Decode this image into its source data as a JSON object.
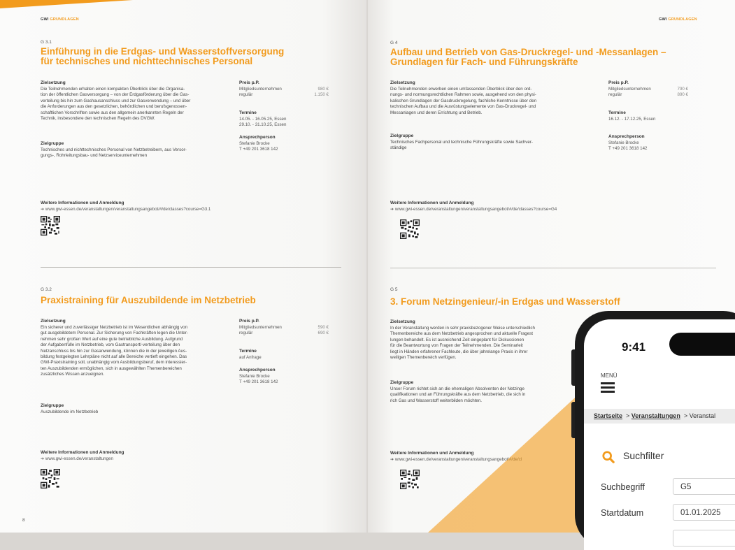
{
  "header": {
    "gwi": "GWI",
    "grundlagen": "GRUNDLAGEN"
  },
  "left_page": {
    "page_number": "8",
    "c1": {
      "code": "G 3.1",
      "title_l1": "Einführung in die Erdgas- und Wasserstoffversorgung",
      "title_l2": "für technisches und nichttechnisches Personal",
      "ziel_label": "Zielsetzung",
      "ziel_lines": [
        "Die Teilnehmenden erhalten einen kompakten Überblick über die Organisa-",
        "tion der öffentlichen Gasversorgung – von der Erdgasförderung über die Gas-",
        "verteilung bis hin zum Gashausanschluss und zur Gasverwendung – und über",
        "die Anforderungen aus den gesetzlichen, behördlichen und berufsgenossen-",
        "schaftlichen Vorschriften sowie aus den allgemein anerkannten Regeln der",
        "Technik, insbesondere den technischen Regeln des DVGW."
      ],
      "gruppe_label": "Zielgruppe",
      "gruppe_lines": [
        "Technisches und nichttechnisches Personal von Netzbetreibern, aus Versor-",
        "gungs-, Rohrleitungsbau- und Netzserviceunternehmen"
      ],
      "preis_label": "Preis p.P.",
      "preis_rows": [
        "Mitgliedsunternehmen",
        "regulär"
      ],
      "preis_vals": [
        "980 €",
        "1.150 €"
      ],
      "termine_label": "Termine",
      "termine": [
        "14.05. - 16.05.25, Essen",
        "29.10. - 31.10.25, Essen"
      ],
      "ansprech_label": "Ansprechperson",
      "ansprech": [
        "Stefanie Brocke",
        "T +49 201 3618 142"
      ],
      "more_label": "Weitere Informationen und Anmeldung",
      "url": "www.gwi-essen.de/veranstaltungen/veranstaltungsangebot/#/de/classes?course=G3.1"
    },
    "c2": {
      "code": "G 3.2",
      "title_l1": "Praxistraining für Auszubildende im Netzbetrieb",
      "ziel_label": "Zielsetzung",
      "ziel_lines": [
        "Ein sicherer und zuverlässiger Netzbetrieb ist im Wesentlichen abhängig von",
        "gut ausgebildetem Personal. Zur Sicherung von Fachkräften legen die Unter-",
        "nehmen sehr großen Wert auf eine gute betriebliche Ausbildung. Aufgrund",
        "der Aufgabenfülle im Netzbetrieb, vom Gastransport/-verteilung über den",
        "Netzanschluss bis hin zur Gasanwendung, können die in der jeweiligen Aus-",
        "bildung festgelegten Lehrpläne nicht auf alle Bereiche vertieft eingehen. Das",
        "GWI-Praxistraining soll, unabhängig vom Ausbildungsberuf, dem interessier-",
        "ten Auszubildenden ermöglichen, sich in ausgewählten Themenbereichen",
        "zusätzliches Wissen anzueignen."
      ],
      "gruppe_label": "Zielgruppe",
      "gruppe_lines": [
        "Auszubildende im Netzbetrieb"
      ],
      "preis_label": "Preis p.P.",
      "preis_rows": [
        "Mitgliedsunternehmen",
        "regulär"
      ],
      "preis_vals": [
        "590 €",
        "690 €"
      ],
      "termine_label": "Termine",
      "termine": [
        "auf Anfrage"
      ],
      "ansprech_label": "Ansprechperson",
      "ansprech": [
        "Stefanie Brocke",
        "T +49 201 3618 142"
      ],
      "more_label": "Weitere Informationen und Anmeldung",
      "url": "www.gwi-essen.de/veranstaltungen"
    }
  },
  "right_page": {
    "c1": {
      "code": "G 4",
      "title_l1": "Aufbau und Betrieb von Gas-Druckregel- und -Messanlagen –",
      "title_l2": "Grundlagen für Fach- und Führungskräfte",
      "ziel_label": "Zielsetzung",
      "ziel_lines": [
        "Die Teilnehmenden erwerben einen umfassenden Überblick über den ord-",
        "nungs- und normungsrechtlichen Rahmen sowie, ausgehend von den physi-",
        "kalischen Grundlagen der Gasdruckregelung, fachliche Kenntnisse über den",
        "technischen Aufbau und die Ausrüstungselemente von Gas-Druckregel- und",
        "Messanlagen und deren Errichtung und Betrieb."
      ],
      "gruppe_label": "Zielgruppe",
      "gruppe_lines": [
        "Technisches Fachpersonal und technische Führungskräfte sowie Sachver-",
        "ständige"
      ],
      "preis_label": "Preis p.P.",
      "preis_rows": [
        "Mitgliedsunternehmen",
        "regulär"
      ],
      "preis_vals": [
        "790 €",
        "890 €"
      ],
      "termine_label": "Termine",
      "termine": [
        "16.12. - 17.12.25, Essen"
      ],
      "ansprech_label": "Ansprechperson",
      "ansprech": [
        "Stefanie Brocke",
        "T +49 201 3618 142"
      ],
      "more_label": "Weitere Informationen und Anmeldung",
      "url": "www.gwi-essen.de/veranstaltungen/veranstaltungsangebot/#/de/classes?course=G4"
    },
    "c2": {
      "code": "G 5",
      "title_l1": "3. Forum Netzingenieur/-in Erdgas und Wasserstoff",
      "ziel_label": "Zielsetzung",
      "ziel_lines": [
        "In der Veranstaltung werden in sehr praxisbezogener Weise unterschiedlich",
        "Themenbereiche aus dem Netzbetrieb angesprochen und aktuelle Fragest",
        "lungen behandelt. Es ist ausreichend Zeit eingeplant für Diskussionen",
        "für die Beantwortung von Fragen der Teilnehmenden. Die Seminarleit",
        "liegt in Händen erfahrener Fachleute, die über jahrelange Praxis in ihrer",
        "weiligen Themenbereich verfügen."
      ],
      "gruppe_label": "Zielgruppe",
      "gruppe_lines": [
        "Unser Forum richtet sich an die ehemaligen Absolventen der Netzinge",
        "qualifikationen und an Führungskräfte aus dem Netzbetrieb, die sich in",
        "rich Gas und Wasserstoff weiterbilden möchten."
      ],
      "more_label": "Weitere Informationen und Anmeldung",
      "url": "www.gwi-essen.de/veranstaltungen/veranstaltungsangebot/#/de/cl"
    }
  },
  "phone": {
    "time": "9:41",
    "menu_label": "MENÜ",
    "breadcrumb": [
      "Startseite",
      "Veranstaltungen",
      "Veranstal"
    ],
    "filter_title": "Suchfilter",
    "fields": [
      {
        "label": "Suchbegriff",
        "value": "G5"
      },
      {
        "label": "Startdatum",
        "value": "01.01.2025"
      }
    ]
  },
  "colors": {
    "accent": "#f29b1d",
    "phone_frame": "#1a1a1a"
  }
}
